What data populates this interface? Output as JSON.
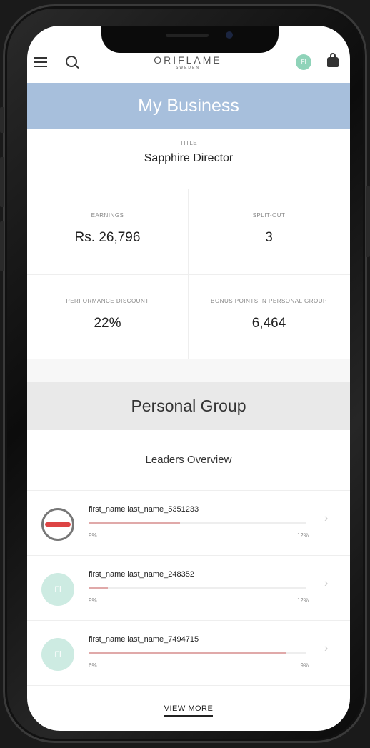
{
  "header": {
    "logo": "ORIFLAME",
    "logo_sub": "SWEDEN",
    "avatar_initials": "Fl"
  },
  "business": {
    "heading": "My Business",
    "title_label": "TITLE",
    "title_value": "Sapphire Director"
  },
  "stats": [
    {
      "label": "EARNINGS",
      "value": "Rs. 26,796"
    },
    {
      "label": "SPLIT-OUT",
      "value": "3"
    },
    {
      "label": "PERFORMANCE DISCOUNT",
      "value": "22%"
    },
    {
      "label": "BONUS POINTS IN PERSONAL GROUP",
      "value": "6,464"
    }
  ],
  "personal_group": {
    "heading": "Personal Group",
    "subheading": "Leaders Overview"
  },
  "leaders": [
    {
      "name": "first_name last_name_5351233",
      "min": "9%",
      "max": "12%",
      "progress": 0.42,
      "avatar": "logo"
    },
    {
      "name": "first_name last_name_248352",
      "min": "9%",
      "max": "12%",
      "progress": 0.09,
      "avatar": "Fl"
    },
    {
      "name": "first_name last_name_7494715",
      "min": "6%",
      "max": "9%",
      "progress": 0.91,
      "avatar": "Fl"
    }
  ],
  "view_more": "VIEW MORE",
  "colors": {
    "business_header": "#a7bfdc",
    "group_header": "#e9e9e9",
    "progress_fill": "#e0a9a9",
    "avatar_bg": "#cdebe2"
  }
}
